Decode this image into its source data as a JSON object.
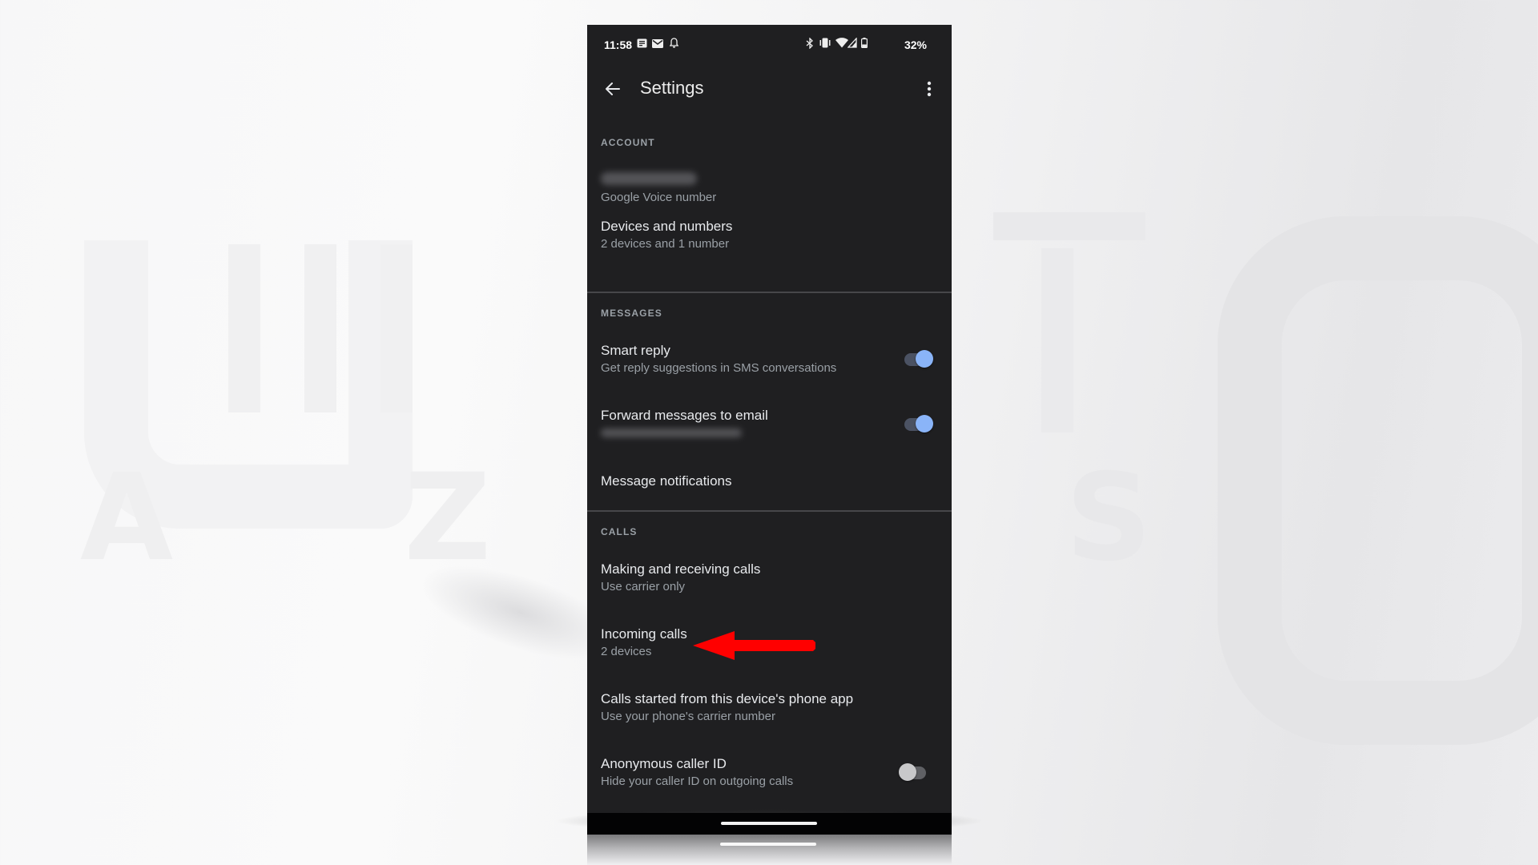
{
  "status_bar": {
    "time": "11:58",
    "left_icons": [
      "news-notification-icon",
      "gmail-icon",
      "bell-icon"
    ],
    "right_icons": [
      "bluetooth-icon",
      "vibrate-icon",
      "wifi-icon",
      "cell-signal-icon",
      "battery-icon"
    ],
    "battery_percent": "32%"
  },
  "app_bar": {
    "title": "Settings",
    "back_icon": "arrow-back-icon",
    "more_icon": "more-vert-icon"
  },
  "sections": {
    "account": {
      "label": "ACCOUNT",
      "items": [
        {
          "title": "",
          "title_redacted": true,
          "subtitle": "Google Voice number"
        },
        {
          "title": "Devices and numbers",
          "subtitle": "2 devices and 1 number"
        }
      ]
    },
    "messages": {
      "label": "MESSAGES",
      "items": [
        {
          "title": "Smart reply",
          "subtitle": "Get reply suggestions in SMS conversations",
          "toggle": true
        },
        {
          "title": "Forward messages to email",
          "subtitle": "",
          "subtitle_redacted": true,
          "toggle": true
        },
        {
          "title": "Message notifications"
        }
      ]
    },
    "calls": {
      "label": "CALLS",
      "items": [
        {
          "title": "Making and receiving calls",
          "subtitle": "Use carrier only"
        },
        {
          "title": "Incoming calls",
          "subtitle": "2 devices"
        },
        {
          "title": "Calls started from this device's phone app",
          "subtitle": "Use your phone's carrier number"
        },
        {
          "title": "Anonymous caller ID",
          "subtitle": "Hide your caller ID on outgoing calls",
          "toggle": false
        }
      ]
    }
  },
  "annotation": {
    "type": "red-arrow",
    "points_to": "Incoming calls",
    "color": "#ff0000"
  },
  "colors": {
    "background_panel": "#1f1f21",
    "toggle_on_knob": "#8ab4f8",
    "toggle_on_track": "#4b5263",
    "toggle_off_knob": "#c8c8ca",
    "primary_text": "#e8eaed",
    "secondary_text": "#9aa0a6"
  },
  "watermark": {
    "letters": "AZAWEBS"
  }
}
